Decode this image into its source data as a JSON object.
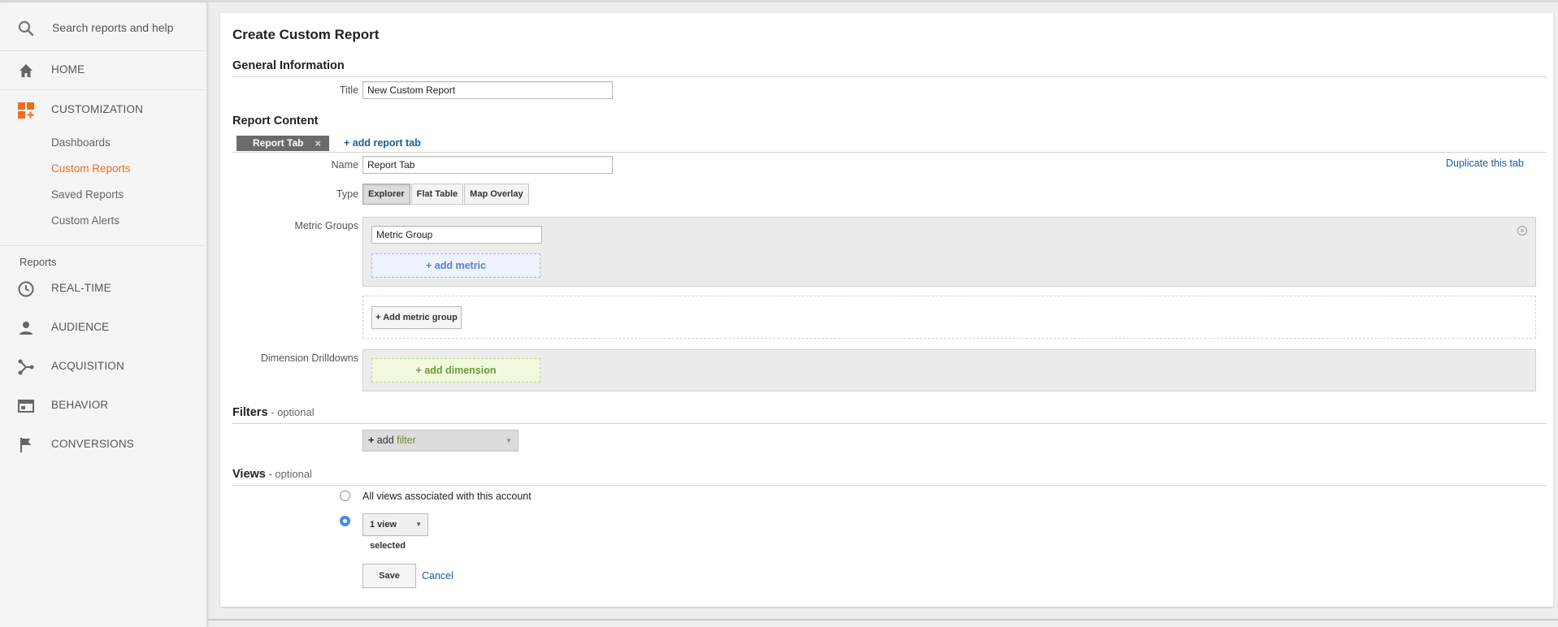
{
  "sidebar": {
    "search_placeholder": "Search reports and help",
    "home_label": "HOME",
    "customization_label": "CUSTOMIZATION",
    "customization_items": [
      "Dashboards",
      "Custom Reports",
      "Saved Reports",
      "Custom Alerts"
    ],
    "active_item": "Custom Reports",
    "reports_heading": "Reports",
    "report_items": [
      "REAL-TIME",
      "AUDIENCE",
      "ACQUISITION",
      "BEHAVIOR",
      "CONVERSIONS"
    ],
    "accent_color": "#ef6c1e"
  },
  "page": {
    "title": "Create Custom Report"
  },
  "general": {
    "heading": "General Information",
    "title_label": "Title",
    "title_value": "New Custom Report"
  },
  "content": {
    "heading": "Report Content",
    "tab_label": "Report Tab",
    "tab_close": "×",
    "add_tab": "+ add report tab",
    "duplicate_tab": "Duplicate this tab",
    "name_label": "Name",
    "name_value": "Report Tab",
    "type_label": "Type",
    "types": [
      "Explorer",
      "Flat Table",
      "Map Overlay"
    ],
    "selected_type": "Explorer",
    "metric_groups_label": "Metric Groups",
    "metric_group_value": "Metric Group",
    "add_metric": "+ add metric",
    "add_metric_group": "+ Add metric group",
    "dimension_label": "Dimension Drilldowns",
    "add_dimension": "+ add dimension"
  },
  "filters": {
    "heading": "Filters",
    "optional": " - optional",
    "add_plus": "+",
    "add_word": " add ",
    "filter_word": "filter"
  },
  "views": {
    "heading": "Views",
    "optional": " - optional",
    "all_views": "All views associated with this account",
    "selected": "1 view selected",
    "selected_option": 2
  },
  "actions": {
    "save": "Save",
    "cancel": "Cancel"
  },
  "colors": {
    "link": "#1a5d9d",
    "radio_on": "#4a89f0",
    "metric_blue": "#5a7ecf",
    "dimension_green": "#6f9a3a"
  }
}
